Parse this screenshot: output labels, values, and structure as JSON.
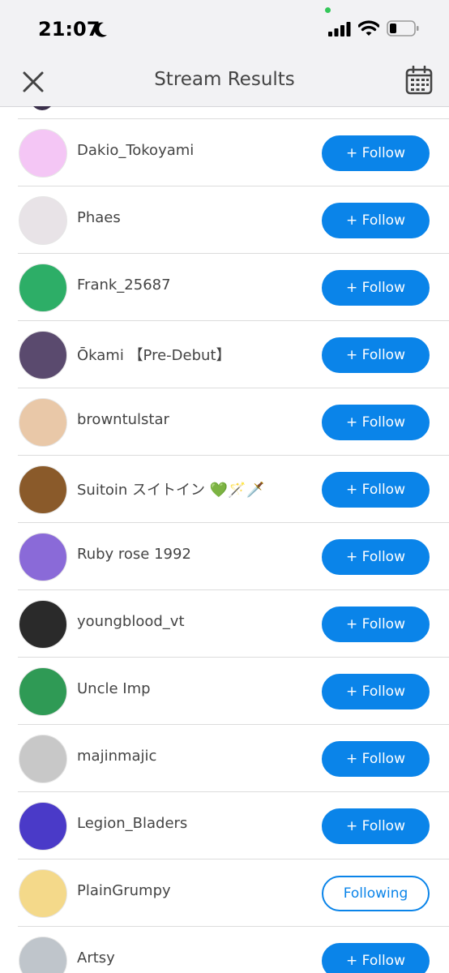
{
  "status": {
    "time": "21:07"
  },
  "header": {
    "title": "Stream Results"
  },
  "icons": {
    "close": "close-icon",
    "calendar": "calendar-icon",
    "moon": "moon-icon",
    "signal": "cellular-signal-icon",
    "wifi": "wifi-icon",
    "battery": "battery-icon"
  },
  "colors": {
    "accent": "#0a84e9",
    "background": "#ffffff",
    "header_bg": "#f2f2f4",
    "divider": "#dcdcdc"
  },
  "users": [
    {
      "name": "Dakio_Tokoyami",
      "action": "+ Follow",
      "following": false,
      "avatar_color": "#f4c6f5"
    },
    {
      "name": "Phaes",
      "action": "+ Follow",
      "following": false,
      "avatar_color": "#e8e3e7"
    },
    {
      "name": "Frank_25687",
      "action": "+ Follow",
      "following": false,
      "avatar_color": "#2dae67"
    },
    {
      "name": "Ōkami 【Pre-Debut】",
      "action": "+ Follow",
      "following": false,
      "avatar_color": "#5a4a6e"
    },
    {
      "name": "browntulstar",
      "action": "+ Follow",
      "following": false,
      "avatar_color": "#e9c8a8"
    },
    {
      "name": "Suitoin スイトイン 💚🪄🗡️",
      "action": "+ Follow",
      "following": false,
      "avatar_color": "#8a5a2a"
    },
    {
      "name": "Ruby rose 1992",
      "action": "+ Follow",
      "following": false,
      "avatar_color": "#8a6ad8"
    },
    {
      "name": "youngblood_vt",
      "action": "+ Follow",
      "following": false,
      "avatar_color": "#2a2a2a"
    },
    {
      "name": "Uncle Imp",
      "action": "+ Follow",
      "following": false,
      "avatar_color": "#2f9a55"
    },
    {
      "name": "majinmajic",
      "action": "+ Follow",
      "following": false,
      "avatar_color": "#c8c8c8"
    },
    {
      "name": "Legion_Bladers",
      "action": "+ Follow",
      "following": false,
      "avatar_color": "#4a3ac8"
    },
    {
      "name": "PlainGrumpy",
      "action": "Following",
      "following": true,
      "avatar_color": "#f4d98a"
    },
    {
      "name": "Artsy",
      "action": "+ Follow",
      "following": false,
      "avatar_color": "#bfc5cb"
    }
  ]
}
